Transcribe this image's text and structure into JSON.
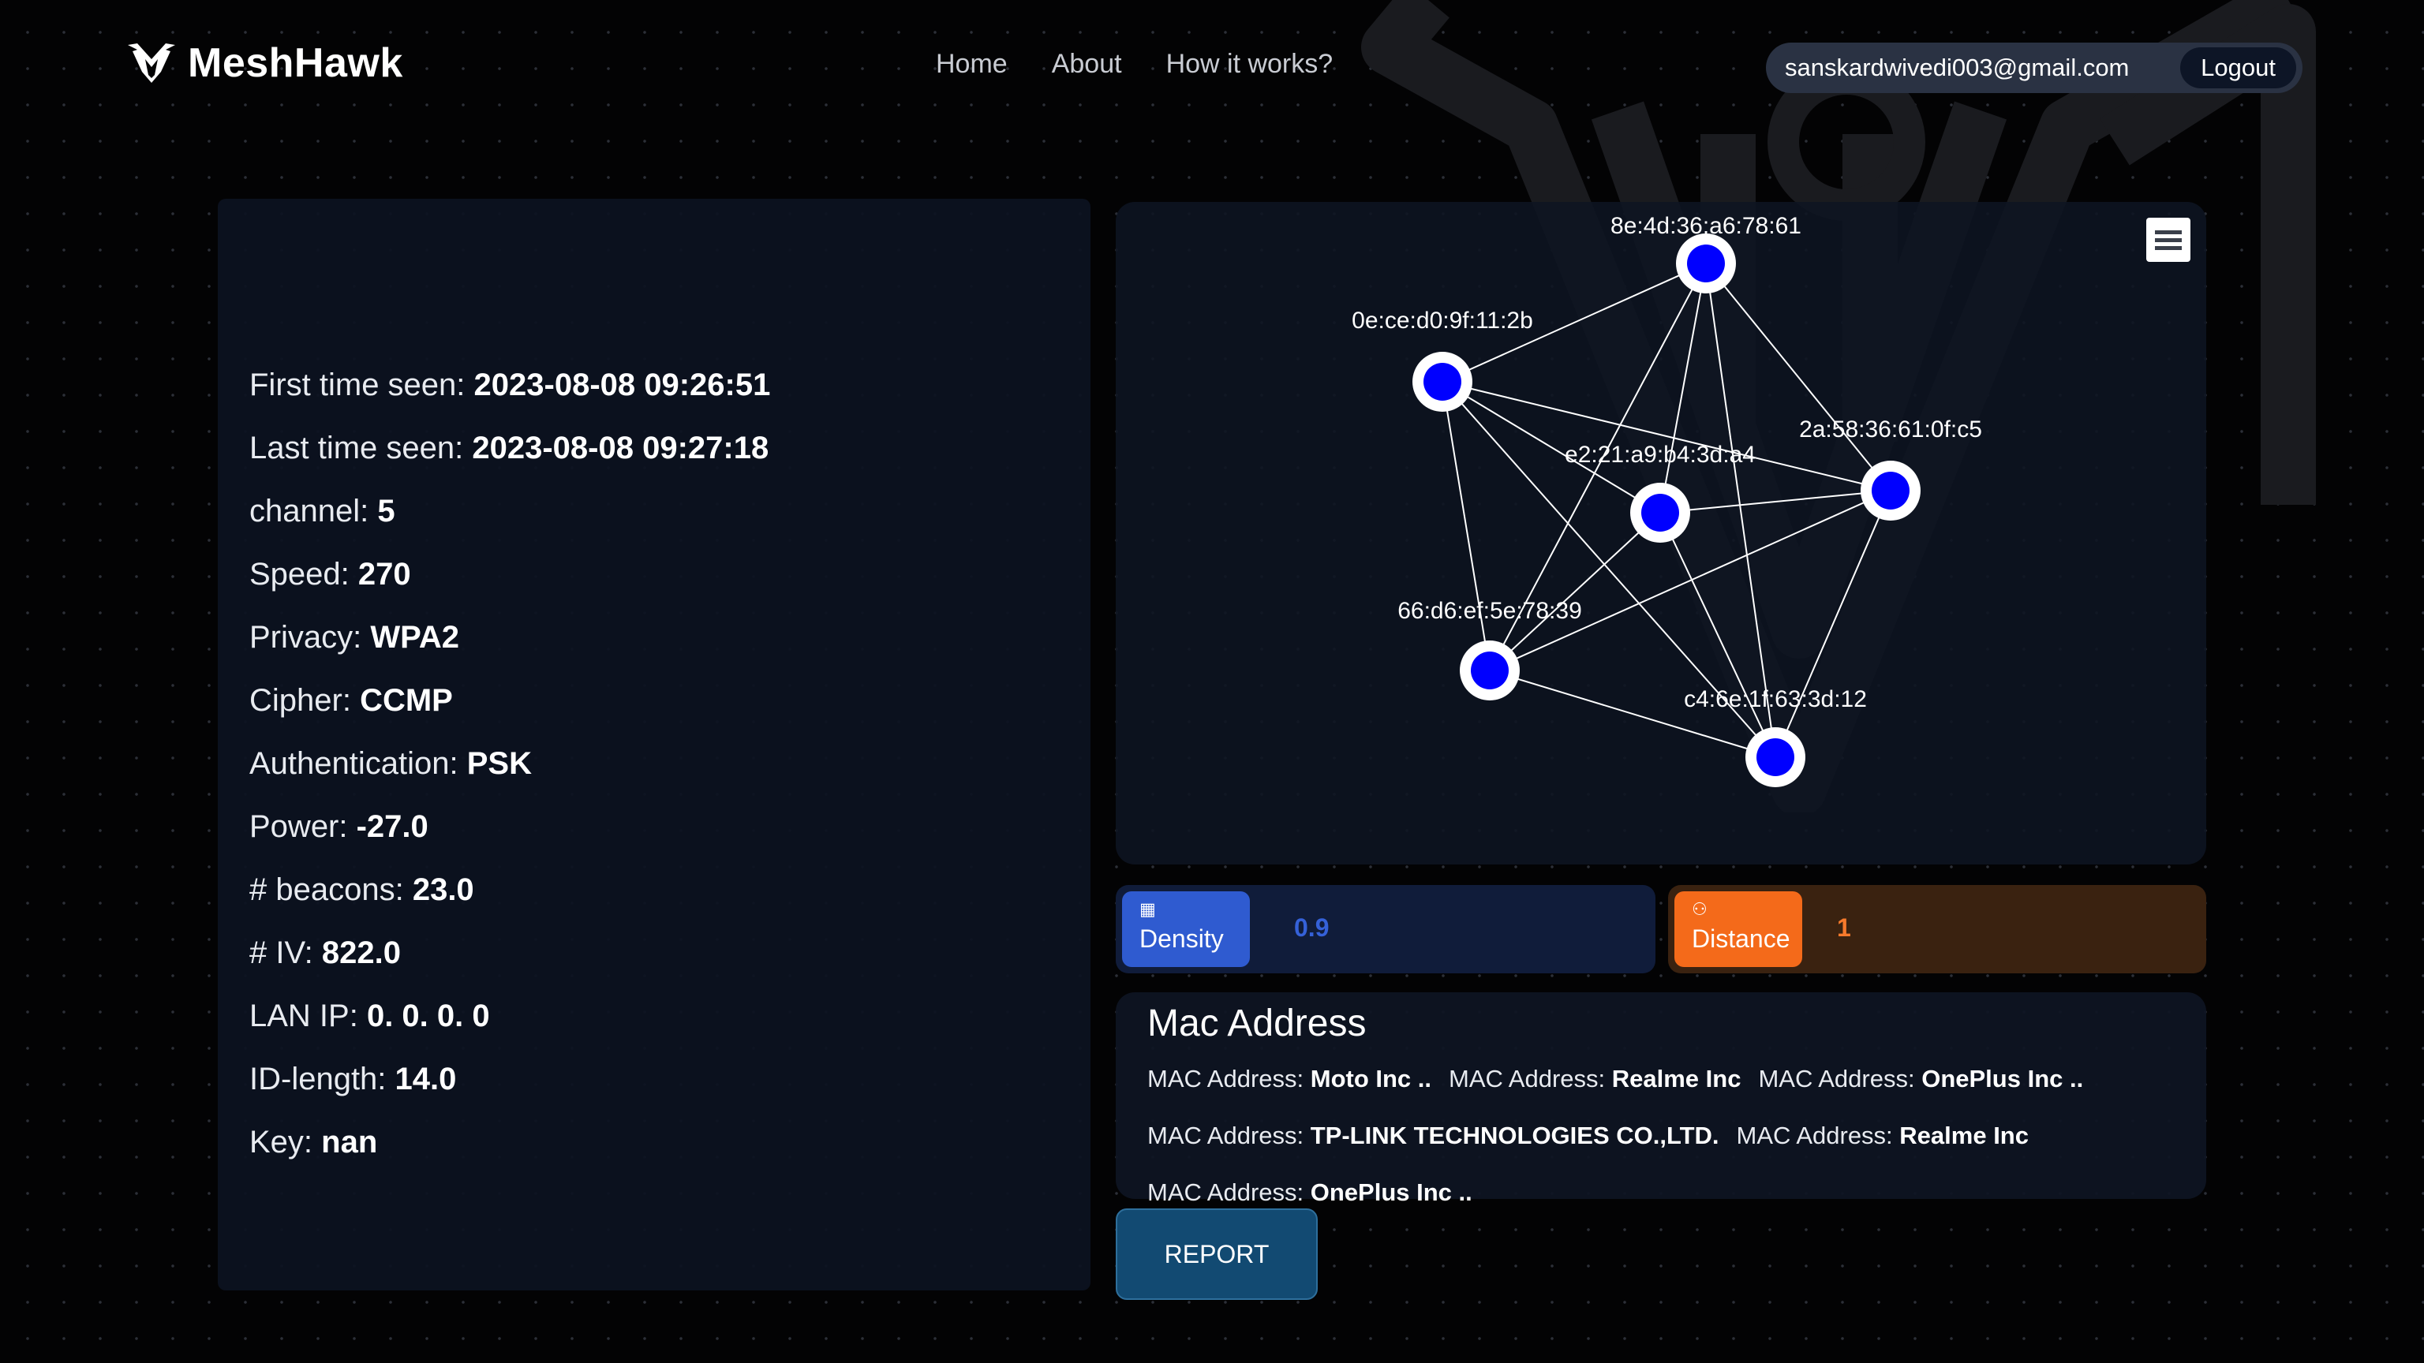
{
  "brand": {
    "name": "MeshHawk"
  },
  "nav": {
    "links": [
      "Home",
      "About",
      "How it works?"
    ]
  },
  "account": {
    "email": "sanskardwivedi003@gmail.com",
    "logout_label": "Logout"
  },
  "info": {
    "rows": [
      {
        "label": "First time seen: ",
        "value": "2023-08-08 09:26:51"
      },
      {
        "label": "Last time seen: ",
        "value": "2023-08-08 09:27:18"
      },
      {
        "label": "channel: ",
        "value": "5"
      },
      {
        "label": "Speed: ",
        "value": "270"
      },
      {
        "label": "Privacy: ",
        "value": "WPA2"
      },
      {
        "label": "Cipher: ",
        "value": "CCMP"
      },
      {
        "label": "Authentication: ",
        "value": "PSK"
      },
      {
        "label": "Power: ",
        "value": "-27.0"
      },
      {
        "label": "# beacons: ",
        "value": "23.0"
      },
      {
        "label": "# IV: ",
        "value": "822.0"
      },
      {
        "label": "LAN IP: ",
        "value": "0. 0. 0. 0"
      },
      {
        "label": "ID-length: ",
        "value": "14.0"
      },
      {
        "label": "Key: ",
        "value": "nan"
      }
    ]
  },
  "graph": {
    "nodes": [
      {
        "id": "8e:4d:36:a6:78:61"
      },
      {
        "id": "0e:ce:d0:9f:11:2b"
      },
      {
        "id": "2a:58:36:61:0f:c5"
      },
      {
        "id": "e2:21:a9:b4:3d:a4"
      },
      {
        "id": "66:d6:ef:5e:78:39"
      },
      {
        "id": "c4:6e:1f:63:3d:12"
      }
    ],
    "edges": [
      [
        "8e:4d:36:a6:78:61",
        "0e:ce:d0:9f:11:2b"
      ],
      [
        "8e:4d:36:a6:78:61",
        "2a:58:36:61:0f:c5"
      ],
      [
        "8e:4d:36:a6:78:61",
        "e2:21:a9:b4:3d:a4"
      ],
      [
        "8e:4d:36:a6:78:61",
        "66:d6:ef:5e:78:39"
      ],
      [
        "8e:4d:36:a6:78:61",
        "c4:6e:1f:63:3d:12"
      ],
      [
        "0e:ce:d0:9f:11:2b",
        "2a:58:36:61:0f:c5"
      ],
      [
        "0e:ce:d0:9f:11:2b",
        "e2:21:a9:b4:3d:a4"
      ],
      [
        "0e:ce:d0:9f:11:2b",
        "66:d6:ef:5e:78:39"
      ],
      [
        "0e:ce:d0:9f:11:2b",
        "c4:6e:1f:63:3d:12"
      ],
      [
        "2a:58:36:61:0f:c5",
        "e2:21:a9:b4:3d:a4"
      ],
      [
        "2a:58:36:61:0f:c5",
        "66:d6:ef:5e:78:39"
      ],
      [
        "2a:58:36:61:0f:c5",
        "c4:6e:1f:63:3d:12"
      ],
      [
        "e2:21:a9:b4:3d:a4",
        "66:d6:ef:5e:78:39"
      ],
      [
        "e2:21:a9:b4:3d:a4",
        "c4:6e:1f:63:3d:12"
      ],
      [
        "66:d6:ef:5e:78:39",
        "c4:6e:1f:63:3d:12"
      ]
    ],
    "node_fill": "#0000ff",
    "node_ring": "#ffffff",
    "edge_color": "#ffffff",
    "menu_icon": "hamburger-icon"
  },
  "stats": {
    "density": {
      "label": "Density",
      "value": "0.9",
      "icon": "grid-icon",
      "color": "#2f5bd0"
    },
    "distance": {
      "label": "Distance",
      "value": "1",
      "icon": "people-icon",
      "color": "#f46a1a"
    }
  },
  "mac": {
    "title": "Mac Address",
    "label": "MAC Address: ",
    "rows": [
      [
        "Moto Inc ..",
        "Realme Inc",
        "OnePlus Inc .."
      ],
      [
        "TP-LINK TECHNOLOGIES CO.,LTD.",
        "Realme Inc"
      ],
      [
        "OnePlus Inc .."
      ]
    ]
  },
  "report": {
    "label": "REPORT"
  }
}
